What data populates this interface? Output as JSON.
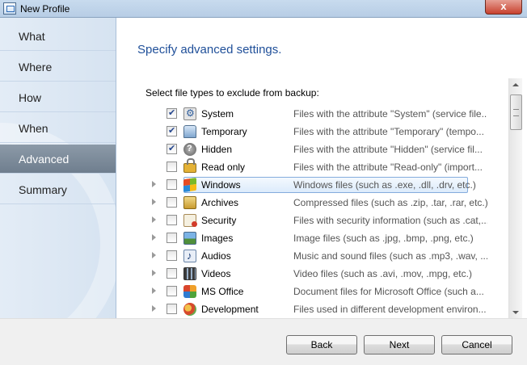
{
  "window": {
    "title": "New Profile",
    "close_glyph": "x"
  },
  "nav": {
    "items": [
      {
        "label": "What",
        "active": false
      },
      {
        "label": "Where",
        "active": false
      },
      {
        "label": "How",
        "active": false
      },
      {
        "label": "When",
        "active": false
      },
      {
        "label": "Advanced",
        "active": true
      },
      {
        "label": "Summary",
        "active": false
      }
    ]
  },
  "main": {
    "title": "Specify advanced settings.",
    "section_label": "Select file types to exclude from backup:",
    "file_types": [
      {
        "name": "System",
        "icon": "system-file-icon",
        "checked": true,
        "expandable": false,
        "selected": false,
        "description": "Files with the attribute \"System\" (service file..."
      },
      {
        "name": "Temporary",
        "icon": "temporary-file-icon",
        "checked": true,
        "expandable": false,
        "selected": false,
        "description": "Files with the attribute \"Temporary\" (tempo..."
      },
      {
        "name": "Hidden",
        "icon": "hidden-file-icon",
        "checked": true,
        "expandable": false,
        "selected": false,
        "description": "Files with the attribute \"Hidden\" (service fil..."
      },
      {
        "name": "Read only",
        "icon": "lock-icon",
        "checked": false,
        "expandable": false,
        "selected": false,
        "description": "Files with the attribute \"Read-only\" (import..."
      },
      {
        "name": "Windows",
        "icon": "windows-logo-icon",
        "checked": false,
        "expandable": true,
        "selected": true,
        "description": "Windows files (such as .exe, .dll, .drv, etc.)"
      },
      {
        "name": "Archives",
        "icon": "archive-icon",
        "checked": false,
        "expandable": true,
        "selected": false,
        "description": "Compressed files (such as .zip, .tar, .rar, etc.)"
      },
      {
        "name": "Security",
        "icon": "certificate-icon",
        "checked": false,
        "expandable": true,
        "selected": false,
        "description": "Files with security information (such as .cat,..."
      },
      {
        "name": "Images",
        "icon": "image-icon",
        "checked": false,
        "expandable": true,
        "selected": false,
        "description": "Image files (such as .jpg, .bmp, .png, etc.)"
      },
      {
        "name": "Audios",
        "icon": "music-note-icon",
        "checked": false,
        "expandable": true,
        "selected": false,
        "description": "Music and sound files (such as .mp3, .wav, ...."
      },
      {
        "name": "Videos",
        "icon": "film-strip-icon",
        "checked": false,
        "expandable": true,
        "selected": false,
        "description": "Video files (such as .avi, .mov, .mpg, etc.)"
      },
      {
        "name": "MS Office",
        "icon": "ms-office-icon",
        "checked": false,
        "expandable": true,
        "selected": false,
        "description": "Document files for Microsoft Office (such a..."
      },
      {
        "name": "Development",
        "icon": "development-icon",
        "checked": false,
        "expandable": true,
        "selected": false,
        "description": "Files used in different development environ..."
      }
    ]
  },
  "footer": {
    "back_label": "Back",
    "next_label": "Next",
    "cancel_label": "Cancel"
  },
  "colors": {
    "accent_title": "#1f4f99",
    "nav_active_bg": "#7f8d9c",
    "selection_border": "#84acdd"
  }
}
